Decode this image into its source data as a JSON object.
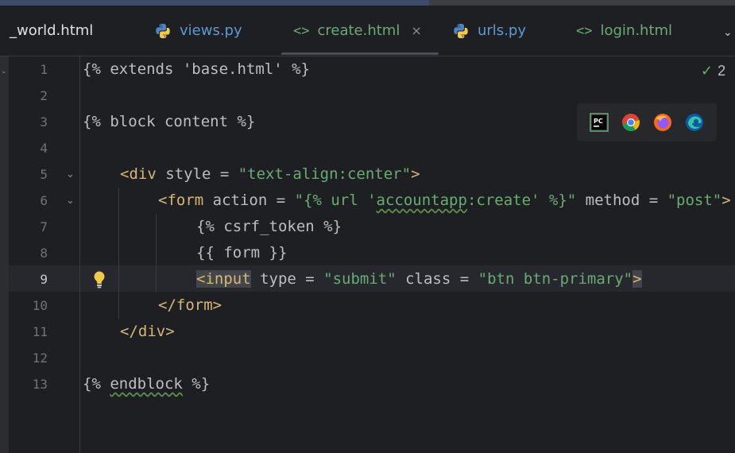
{
  "tabs": [
    {
      "label": "_world.html",
      "icon": "html-tag-icon",
      "color": "#dfe1e5"
    },
    {
      "label": "views.py",
      "icon": "python-icon",
      "color": "#5a9bd5"
    },
    {
      "label": "create.html",
      "icon": "html-tag-icon",
      "color": "#6aab73",
      "active": true,
      "close": "×"
    },
    {
      "label": "urls.py",
      "icon": "python-icon",
      "color": "#5a9bd5"
    },
    {
      "label": "login.html",
      "icon": "html-tag-icon",
      "color": "#6aab73"
    }
  ],
  "tag_icon_glyph": "<>",
  "tab_menu": "⌄",
  "inspections": {
    "check": "✓",
    "count": "2"
  },
  "browsers": [
    "pycharm-icon",
    "chrome-icon",
    "firefox-icon",
    "edge-icon"
  ],
  "editor": {
    "line_numbers": [
      "1",
      "2",
      "3",
      "4",
      "5",
      "6",
      "7",
      "8",
      "9",
      "10",
      "11",
      "12",
      "13"
    ],
    "current_line": "9",
    "lines": {
      "l1": "{% extends 'base.html' %}",
      "l3": "{% block content %}",
      "l5_tag_open": "<div",
      "l5_attr": " style = ",
      "l5_str": "\"text-align:center\"",
      "l5_close": ">",
      "l6_tag_open": "<form",
      "l6_attr": " action = ",
      "l6_str_a": "\"{% url '",
      "l6_str_b": "accountapp",
      "l6_str_c": ":create' %}\"",
      "l6_attr2": " method = ",
      "l6_str2": "\"post\"",
      "l6_close": ">",
      "l7": "{% csrf_token %}",
      "l8": "{{ form }}",
      "l9_tag_open": "<input",
      "l9_attr": " type = ",
      "l9_str": "\"submit\"",
      "l9_attr2": " class = ",
      "l9_str2": "\"btn btn-primary\"",
      "l9_close": ">",
      "l10": "</form>",
      "l11": "</div>",
      "l13_a": "{% ",
      "l13_b": "endblock",
      "l13_c": " %}"
    }
  },
  "colors": {
    "background": "#1e1f22",
    "tag": "#d5b778",
    "string": "#6aab73",
    "text": "#bcbec4",
    "line_number": "#6f737a",
    "current_line_bg": "#26282e"
  }
}
